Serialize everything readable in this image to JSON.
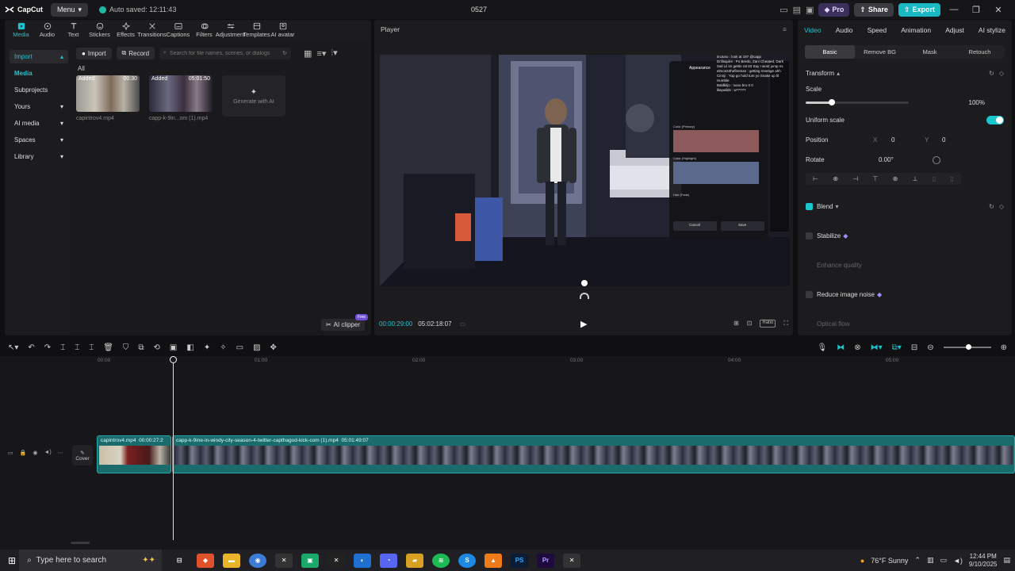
{
  "app": {
    "logo_text": "CapCut",
    "menu_label": "Menu",
    "autosave": "Auto saved: 12:11:43",
    "project_title": "0527",
    "pro_label": "Pro",
    "share_label": "Share",
    "export_label": "Export",
    "accent": "#19c5cf"
  },
  "toolbar": [
    {
      "label": "Media",
      "icon": "media-icon"
    },
    {
      "label": "Audio",
      "icon": "audio-icon"
    },
    {
      "label": "Text",
      "icon": "text-icon"
    },
    {
      "label": "Stickers",
      "icon": "stickers-icon"
    },
    {
      "label": "Effects",
      "icon": "effects-icon"
    },
    {
      "label": "Transitions",
      "icon": "transitions-icon"
    },
    {
      "label": "Captions",
      "icon": "captions-icon"
    },
    {
      "label": "Filters",
      "icon": "filters-icon"
    },
    {
      "label": "Adjustment",
      "icon": "adjustment-icon"
    },
    {
      "label": "Templates",
      "icon": "templates-icon"
    },
    {
      "label": "AI avatar",
      "icon": "ai-avatar-icon"
    }
  ],
  "sidenav": [
    {
      "label": "Import",
      "style": "hl"
    },
    {
      "label": "Media",
      "style": "plain"
    },
    {
      "label": "Subprojects",
      "style": ""
    },
    {
      "label": "Yours",
      "style": ""
    },
    {
      "label": "AI media",
      "style": ""
    },
    {
      "label": "Spaces",
      "style": ""
    },
    {
      "label": "Library",
      "style": ""
    }
  ],
  "media": {
    "import_label": "Import",
    "record_label": "Record",
    "search_placeholder": "Search for file names, scenes, or dialogs",
    "filter_label": "All",
    "items": [
      {
        "tag": "Added",
        "duration": "00:30",
        "name": "capintrov4.mp4"
      },
      {
        "tag": "Added",
        "duration": "05:01:50",
        "name": "capp-k-9in...om (1).mp4"
      }
    ],
    "generate_label": "Generate with AI",
    "ai_clipper_label": "AI clipper",
    "free_badge": "Free"
  },
  "player": {
    "title": "Player",
    "current_time": "00:00:29:00",
    "total_time": "05:02:18:07",
    "ratio_label": "Ratio",
    "overlay": {
      "appearance": "Appearance",
      "cancel": "Cancel",
      "save": "Save",
      "hair": "Hair (Fade)",
      "color_primary": "Color (Primary)",
      "color_highlight": "Color (Highlight)",
      "chat": [
        "imJuno : look at 197 @capp",
        "Drillsquire : Po Bredo, Zani Cheated, Dark Sail Lil im gettin rat 83 Say I wont jump ns",
        "elmo444hefireman : getting revenge ahh",
        "Cinnji : Yup go hold tum yo Snake up lil Humble",
        "Baldkiljo : nooo bro 0 0",
        "lilaywilds : w*????"
      ]
    }
  },
  "details": {
    "tabs": [
      "Video",
      "Audio",
      "Speed",
      "Animation",
      "Adjust",
      "AI stylize"
    ],
    "subtabs": [
      "Basic",
      "Remove BG",
      "Mask",
      "Retouch"
    ],
    "transform": "Transform",
    "scale_label": "Scale",
    "scale_value": "100%",
    "scale_fraction": 0.25,
    "uniform_scale": "Uniform scale",
    "position_label": "Position",
    "pos_x": "0",
    "pos_y": "0",
    "x_label": "X",
    "y_label": "Y",
    "rotate_label": "Rotate",
    "rotate_value": "0.00°",
    "blend": "Blend",
    "stabilize": "Stabilize",
    "enhance_quality": "Enhance quality",
    "reduce_noise": "Reduce image noise",
    "optical_flow": "Optical flow"
  },
  "timeline": {
    "ruler": [
      "00:00",
      "01:00",
      "02:00",
      "03:00",
      "04:00",
      "05:00"
    ],
    "cover_label": "Cover",
    "clips": [
      {
        "name": "capintrov4.mp4",
        "duration": "00:00:27:2"
      },
      {
        "name": "capp-k-9ine-in-windy-city-season-4-twitter-capthagod-kick-com (1).mp4",
        "duration": "05:01:49:07"
      }
    ]
  },
  "taskbar": {
    "search_placeholder": "Type here to search",
    "weather": "76°F  Sunny",
    "time": "12:44 PM",
    "date": "9/10/2025",
    "apps": [
      "PS",
      "Pr"
    ]
  }
}
